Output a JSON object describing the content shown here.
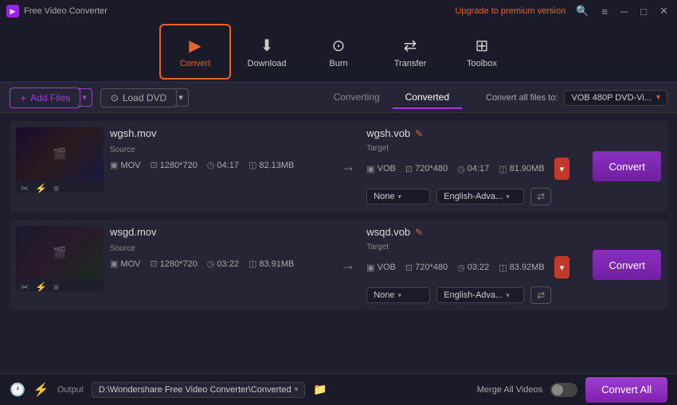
{
  "titleBar": {
    "appName": "Free Video Converter",
    "upgradeText": "Upgrade to premium version",
    "searchIcon": "🔍",
    "menuIcon": "≡",
    "minIcon": "─",
    "maxIcon": "□",
    "closeIcon": "✕"
  },
  "nav": {
    "items": [
      {
        "id": "convert",
        "label": "Convert",
        "icon": "▶",
        "active": true
      },
      {
        "id": "download",
        "label": "Download",
        "icon": "⬇"
      },
      {
        "id": "burn",
        "label": "Burn",
        "icon": "⊙"
      },
      {
        "id": "transfer",
        "label": "Transfer",
        "icon": "⇄"
      },
      {
        "id": "toolbox",
        "label": "Toolbox",
        "icon": "⊞"
      }
    ]
  },
  "toolbar": {
    "addFilesLabel": "Add Files",
    "loadDVDLabel": "Load DVD",
    "tabs": [
      {
        "id": "converting",
        "label": "Converting"
      },
      {
        "id": "converted",
        "label": "Converted",
        "active": true
      }
    ],
    "convertAllLabel": "Convert all files to:",
    "formatLabel": "VOB 480P DVD-Vi..."
  },
  "files": [
    {
      "id": "file1",
      "sourceName": "wgsh.mov",
      "targetName": "wgsh.vob",
      "source": {
        "label": "Source",
        "format": "MOV",
        "resolution": "1280*720",
        "duration": "04:17",
        "size": "82.13MB"
      },
      "target": {
        "label": "Target",
        "format": "VOB",
        "resolution": "720*480",
        "duration": "04:17",
        "size": "81.90MB"
      },
      "subtitle": "None",
      "audio": "English-Adva...",
      "convertBtn": "Convert"
    },
    {
      "id": "file2",
      "sourceName": "wsgd.mov",
      "targetName": "wsqd.vob",
      "source": {
        "label": "Source",
        "format": "MOV",
        "resolution": "1280*720",
        "duration": "03:22",
        "size": "83.91MB"
      },
      "target": {
        "label": "Target",
        "format": "VOB",
        "resolution": "720*480",
        "duration": "03:22",
        "size": "83.92MB"
      },
      "subtitle": "None",
      "audio": "English-Adva...",
      "convertBtn": "Convert"
    }
  ],
  "bottomBar": {
    "outputLabel": "Output",
    "outputPath": "D:\\Wondershare Free Video Converter\\Converted",
    "mergeLabel": "Merge All Videos",
    "convertAllBtn": "Convert All"
  }
}
